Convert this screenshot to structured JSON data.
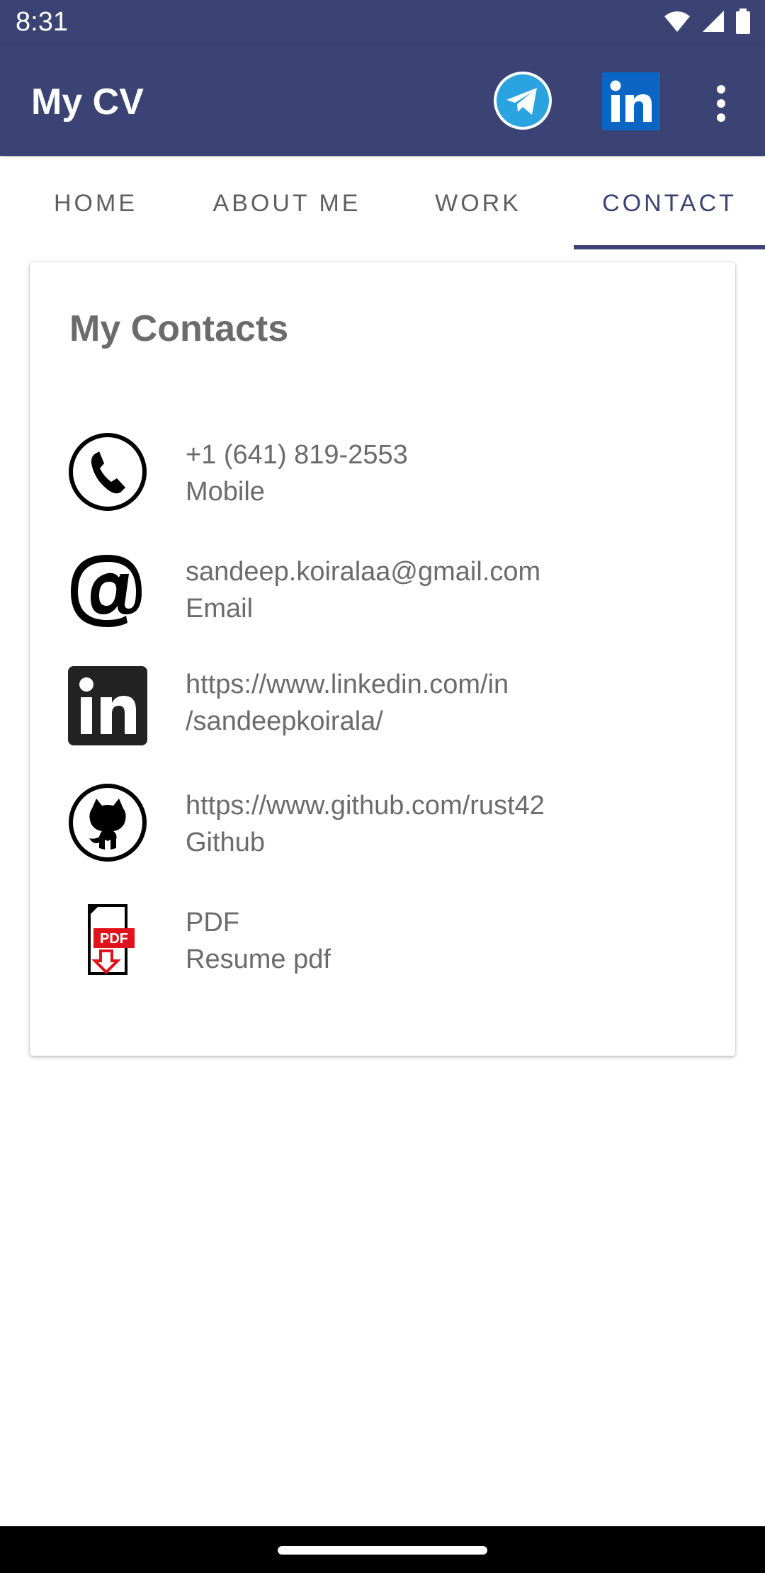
{
  "status_bar": {
    "time": "8:31"
  },
  "app_bar": {
    "title": "My CV",
    "actions": [
      "telegram-icon",
      "linkedin-icon",
      "more-vert-icon"
    ]
  },
  "tabs": [
    {
      "label": "HOME",
      "active": false
    },
    {
      "label": "ABOUT ME",
      "active": false
    },
    {
      "label": "WORK",
      "active": false
    },
    {
      "label": "CONTACT",
      "active": true
    }
  ],
  "card": {
    "title": "My Contacts",
    "contacts": [
      {
        "icon": "phone-icon",
        "primary": "+1 (641) 819-2553",
        "secondary": "Mobile"
      },
      {
        "icon": "at-icon",
        "primary": "sandeep.koiralaa@gmail.com",
        "secondary": "Email"
      },
      {
        "icon": "linkedin-icon",
        "primary": "https://www.linkedin.com/in",
        "secondary": "/sandeepkoirala/"
      },
      {
        "icon": "github-icon",
        "primary": "https://www.github.com/rust42",
        "secondary": "Github"
      },
      {
        "icon": "pdf-icon",
        "primary": "PDF",
        "secondary": "Resume pdf"
      }
    ]
  },
  "colors": {
    "primary": "#3a4374",
    "text_gray": "#6b6b6b",
    "telegram_blue": "#2aa3e0",
    "linkedin_blue": "#0a66c2",
    "pdf_red": "#e0121b"
  }
}
